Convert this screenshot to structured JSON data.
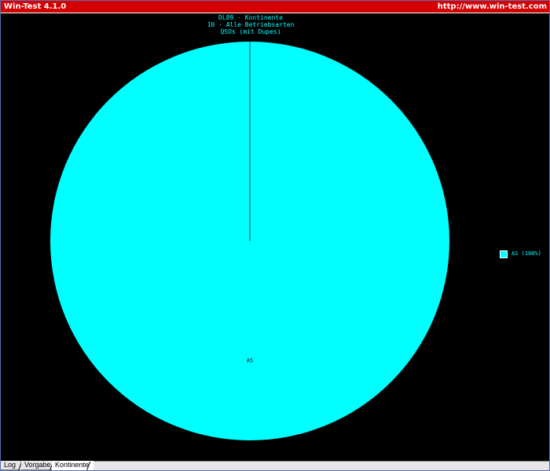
{
  "window": {
    "title": "Win-Test 4.1.0",
    "url": "http://www.win-test.com"
  },
  "chart_data": {
    "type": "pie",
    "title_lines": [
      "DL89 - Kontinente",
      "10 - Alle Betriebsarten",
      "QSOs (mit Dupes)"
    ],
    "categories": [
      "AS"
    ],
    "values": [
      100
    ],
    "slice_labels": [
      "AS"
    ],
    "legend": {
      "placement": "right",
      "entries": [
        "AS (100%)"
      ]
    },
    "colors": [
      "#00ffff"
    ]
  },
  "tabs": [
    {
      "label": "Log",
      "active": false
    },
    {
      "label": "Vorgabe",
      "active": false
    },
    {
      "label": "Kontinente",
      "active": true
    }
  ],
  "colors": {
    "titlebar": "#d40000",
    "background": "#000000",
    "accent": "#00ffff"
  }
}
